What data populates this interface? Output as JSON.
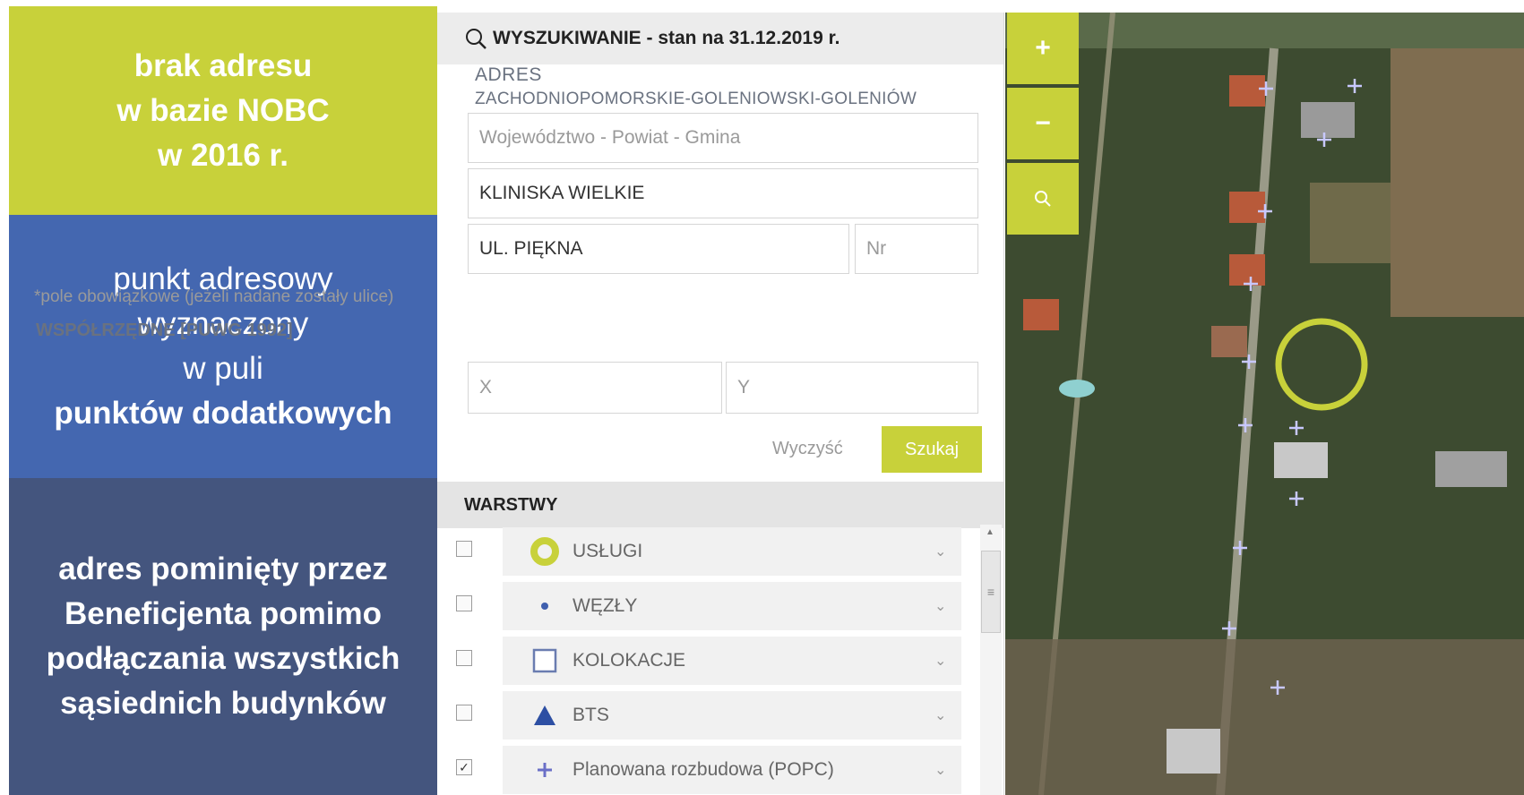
{
  "notes": {
    "top": [
      "brak adresu",
      "w bazie NOBC",
      "w 2016 r."
    ],
    "middle": [
      "punkt adresowy",
      "wyznaczony",
      "w puli"
    ],
    "middle_bold": "punktów dodatkowych",
    "bottom": [
      "adres pominięty przez",
      "Beneficjenta pomimo",
      "podłączania wszystkich",
      "sąsiednich budynków"
    ]
  },
  "search": {
    "header": "WYSZUKIWANIE - stan na 31.12.2019 r.",
    "address_label": "ADRES",
    "address_value": "ZACHODNIOPOMORSKIE-GOLENIOWSKI-GOLENIÓW",
    "region_placeholder": "Województwo - Powiat - Gmina",
    "city_value": "KLINISKA WIELKIE",
    "street_value": "UL. PIĘKNA",
    "number_placeholder": "Nr",
    "hint": "*pole obowiązkowe (jeżeli nadane zostały ulice)",
    "coord_label": "WSPÓŁRZĘDNE [PUWG 1992]",
    "x_placeholder": "X",
    "y_placeholder": "Y",
    "clear_label": "Wyczyść",
    "search_label": "Szukaj"
  },
  "layers": {
    "header": "WARSTWY",
    "items": [
      {
        "label": "USŁUGI",
        "checked": false,
        "icon": "ring-icon",
        "color": "#c8d13a"
      },
      {
        "label": "WĘZŁY",
        "checked": false,
        "icon": "dot-icon",
        "color": "#3f5fae"
      },
      {
        "label": "KOLOKACJE",
        "checked": false,
        "icon": "square-outline-icon",
        "color": "#6a7cb0"
      },
      {
        "label": "BTS",
        "checked": false,
        "icon": "triangle-icon",
        "color": "#2d4fa3"
      },
      {
        "label": "Planowana rozbudowa (POPC)",
        "checked": true,
        "icon": "plus-icon",
        "color": "#6a6fc7"
      }
    ]
  },
  "map": {
    "zoom_in": "+",
    "zoom_out": "−",
    "highlight_color": "#c8d13a",
    "marker_color": "#b8b8ff"
  }
}
